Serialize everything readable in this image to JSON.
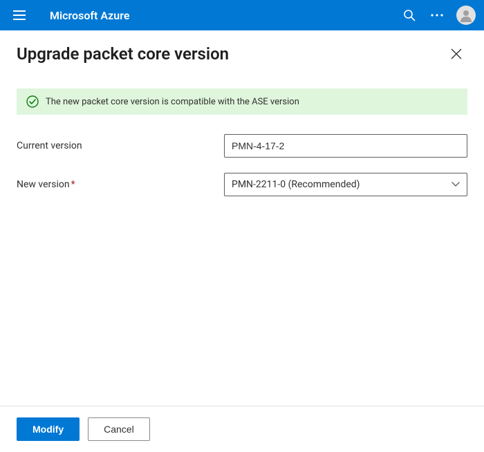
{
  "header": {
    "brand": "Microsoft Azure"
  },
  "panel": {
    "title": "Upgrade packet core version"
  },
  "status": {
    "message": "The new packet core version is compatible with the ASE version",
    "icon_color": "#107c10",
    "bg_color": "#dff6dd"
  },
  "form": {
    "current_label": "Current version",
    "current_value": "PMN-4-17-2",
    "new_label": "New version",
    "new_value": "PMN-2211-0 (Recommended)"
  },
  "footer": {
    "primary": "Modify",
    "secondary": "Cancel"
  }
}
